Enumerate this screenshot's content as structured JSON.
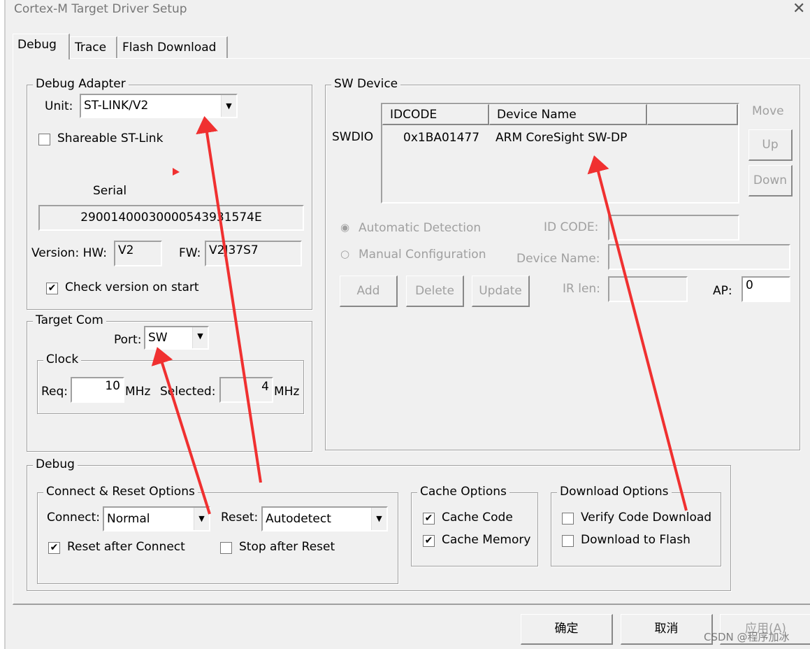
{
  "window": {
    "title": "Cortex-M Target Driver Setup",
    "close": "✕"
  },
  "tabs": [
    "Debug",
    "Trace",
    "Flash Download"
  ],
  "adapter": {
    "label": "Debug Adapter",
    "unit_label": "Unit:",
    "unit": "ST-LINK/V2",
    "shareable": "Shareable ST-Link",
    "serial_label": "Serial",
    "serial": "29001400030000543931574E",
    "version_label": "Version: HW:",
    "hw": "V2",
    "fw_label": "FW:",
    "fw": "V2J37S7",
    "check_version": "Check version on start"
  },
  "target": {
    "label": "Target Com",
    "port_label": "Port:",
    "port": "SW",
    "clock_label": "Clock",
    "req_label": "Req:",
    "req": "10",
    "mhz": "MHz",
    "selected_label": "Selected:",
    "selected": "4"
  },
  "sw": {
    "label": "SW Device",
    "swdio": "SWDIO",
    "cols": [
      "IDCODE",
      "Device Name"
    ],
    "row": {
      "idcode": "0x1BA01477",
      "name": "ARM CoreSight SW-DP"
    },
    "move": "Move",
    "up": "Up",
    "down": "Down",
    "auto": "Automatic Detection",
    "manual": "Manual Configuration",
    "id_code_label": "ID CODE:",
    "device_name_label": "Device Name:",
    "irlen_label": "IR len:",
    "ap_label": "AP:",
    "ap": "0",
    "add": "Add",
    "delete": "Delete",
    "update": "Update"
  },
  "debug": {
    "label": "Debug",
    "cr_label": "Connect & Reset Options",
    "connect_label": "Connect:",
    "connect": "Normal",
    "reset_label": "Reset:",
    "reset": "Autodetect",
    "reset_after": "Reset after Connect",
    "stop_after": "Stop after Reset",
    "cache_label": "Cache Options",
    "cache_code": "Cache Code",
    "cache_memory": "Cache Memory",
    "dl_label": "Download Options",
    "verify": "Verify Code Download",
    "dl_flash": "Download to Flash"
  },
  "buttons": {
    "ok": "确定",
    "cancel": "取消",
    "apply": "应用(A)"
  },
  "watermark": "CSDN @程序加冰",
  "annotation_color": "#f03030"
}
